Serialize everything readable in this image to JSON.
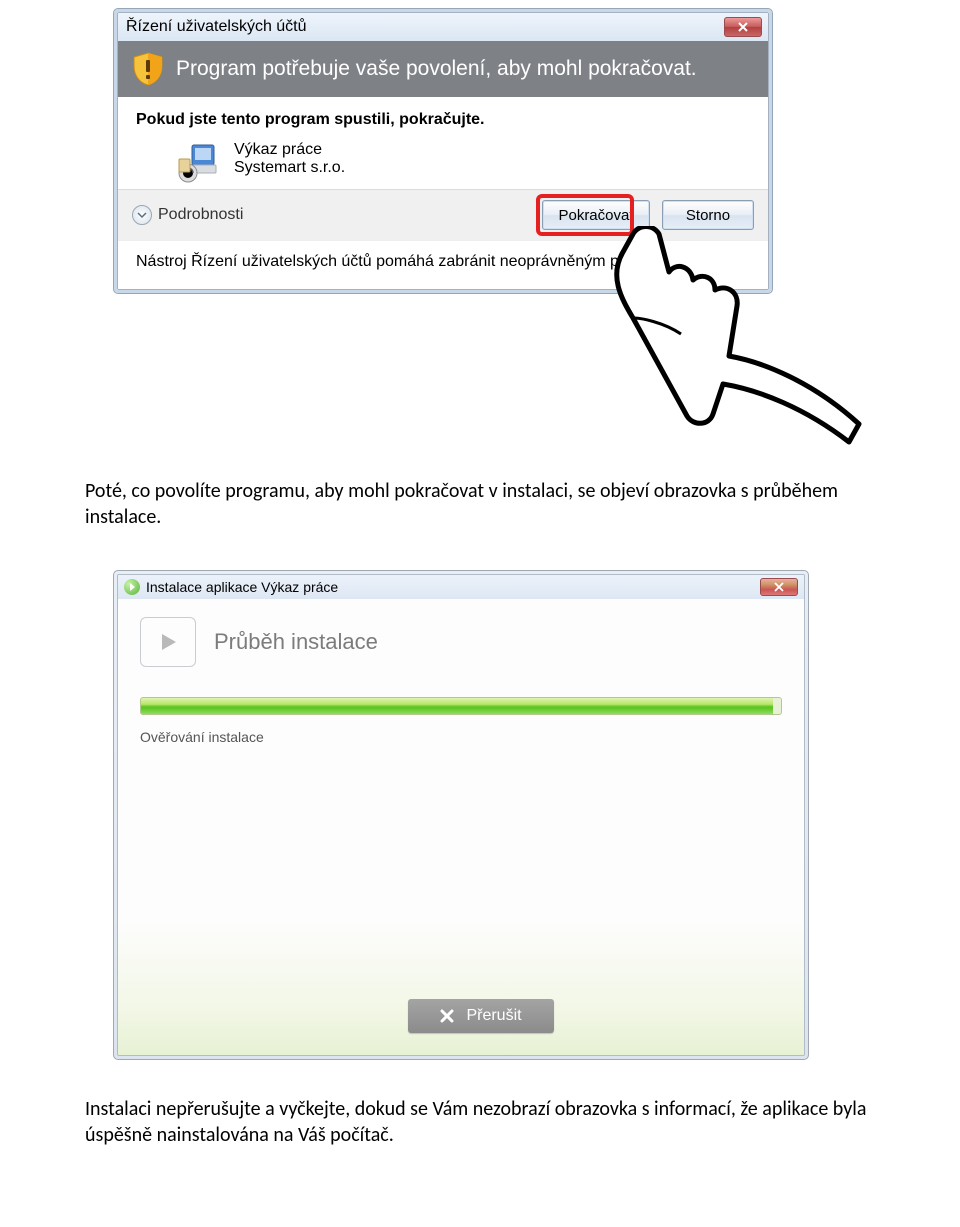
{
  "uac": {
    "title": "Řízení uživatelských účtů",
    "banner": "Program potřebuje vaše povolení, aby mohl pokračovat.",
    "instruction": "Pokud jste tento program spustili, pokračujte.",
    "program_name": "Výkaz práce",
    "publisher": "Systemart s.r.o.",
    "details_label": "Podrobnosti",
    "continue_button": "Pokračovat",
    "cancel_button": "Storno",
    "help_text": "Nástroj Řízení uživatelských účtů pomáhá zabránit neoprávněným počítači."
  },
  "doc": {
    "paragraph1": "Poté, co povolíte programu, aby mohl pokračovat v instalaci, se objeví obrazovka s průběhem instalace.",
    "paragraph2": "Instalaci nepřerušujte a vyčkejte, dokud se Vám nezobrazí obrazovka s informací, že aplikace byla úspěšně nainstalována na Váš počítač."
  },
  "installer": {
    "title": "Instalace aplikace Výkaz práce",
    "heading": "Průběh instalace",
    "status": "Ověřování instalace",
    "cancel_button": "Přerušit"
  }
}
